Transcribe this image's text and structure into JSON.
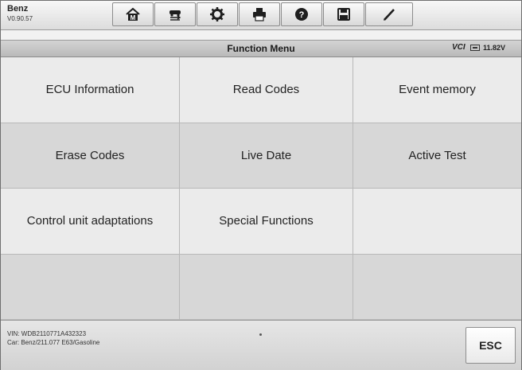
{
  "app": {
    "name": "Benz",
    "version": "V0.90.57"
  },
  "toolbar": [
    {
      "name": "home",
      "icon": "home-icon"
    },
    {
      "name": "vehicle-swap",
      "icon": "car-swap-icon"
    },
    {
      "name": "settings",
      "icon": "gear-icon"
    },
    {
      "name": "print",
      "icon": "printer-icon"
    },
    {
      "name": "help",
      "icon": "help-icon"
    },
    {
      "name": "save",
      "icon": "save-icon"
    },
    {
      "name": "data-logging",
      "icon": "pen-icon"
    }
  ],
  "header": {
    "title": "Function Menu",
    "vci_label": "VCI",
    "battery_icon": "battery-icon",
    "voltage": "11.82V"
  },
  "menu": {
    "rows": [
      [
        "ECU Information",
        "Read Codes",
        "Event memory"
      ],
      [
        "Erase Codes",
        "Live Date",
        "Active Test"
      ],
      [
        "Control unit adaptations",
        "Special Functions",
        ""
      ],
      [
        "",
        "",
        ""
      ]
    ]
  },
  "footer": {
    "vin": "VIN: WDB2110771A432323",
    "car": "Car: Benz/211.077 E63/Gasoline",
    "esc_label": "ESC"
  }
}
